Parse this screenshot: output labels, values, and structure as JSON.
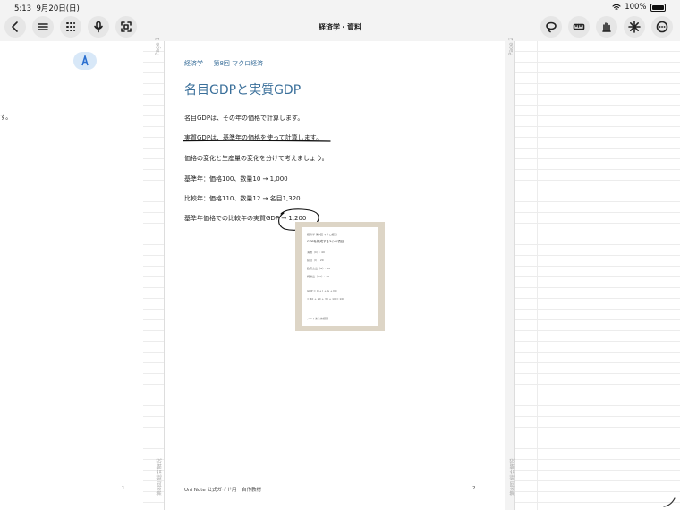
{
  "status": {
    "time": "5:13",
    "date": "9月20日(日)",
    "battery": "100%"
  },
  "toolbar": {
    "title": "経済学・資料",
    "left_icons": [
      "chevron-left-icon",
      "menu-icon",
      "grid-icon",
      "microphone-icon",
      "scan-icon"
    ],
    "right_icons": [
      "lasso-icon",
      "ruler-icon",
      "hand-icon",
      "sparkle-icon",
      "more-icon"
    ]
  },
  "left_page": {
    "fragment": "す。"
  },
  "page1": {
    "side_label_top": "Page 1",
    "side_label_bottom": "第8回 総合解説",
    "breadcrumb": "経済学 ｜ 第8回 マクロ経済",
    "title": "名目GDPと実質GDP",
    "lines": [
      "名目GDPは、その年の価格で計算します。",
      "実質GDPは、基準年の価格を使って計算します。",
      "価格の変化と生産量の変化を分けて考えましょう。",
      "基準年：価格100、数量10 → 1,000",
      "比較年：価格110、数量12 → 名目1,320",
      "基準年価格での比較年の実質GDP → 1,200"
    ],
    "footer": "Uni Note 公式ガイド用　自作教材",
    "page_num_left": "1",
    "page_num_right": "2"
  },
  "thumbnail": {
    "lines": [
      "経済学 第8回 マクロ経済",
      "GDPを構成する3つの項目",
      "消費（C）: 40",
      "投資（I）: 20",
      "政府支出（G）: 30",
      "純輸出（NX）: 10",
      "GDP = C + I + G + NX",
      "= 40 + 20 + 30 + 10 = 100",
      "ノートまとめ練習"
    ]
  },
  "page2": {
    "side_label_top": "Page 2",
    "side_label_bottom": "第8回 総合解説"
  },
  "colors": {
    "accent": "#3a6f9a",
    "pen": "#2a6fd0",
    "thumb_frame": "#ddd5c6"
  }
}
